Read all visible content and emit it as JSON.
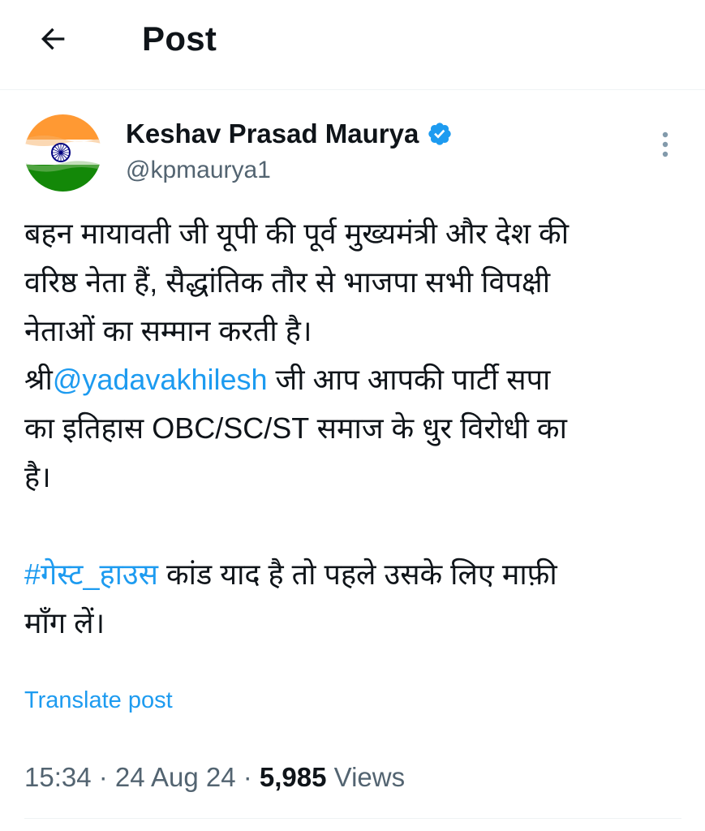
{
  "header": {
    "back_icon": "arrow-left-icon",
    "title": "Post"
  },
  "author": {
    "name": "Keshav Prasad Maurya",
    "handle": "@kpmaurya1",
    "verified_icon": "verified-badge-icon",
    "avatar_icon": "india-flag-avatar",
    "more_icon": "more-vertical-icon"
  },
  "tweet": {
    "line_1": "बहन मायावती जी यूपी की पूर्व मुख्यमंत्री और देश की",
    "line_2": "वरिष्ठ नेता हैं, सैद्धांतिक तौर से भाजपा सभी विपक्षी",
    "line_3": "नेताओं का सम्मान करती है।",
    "line_4_prefix": "श्री",
    "mention": "@yadavakhilesh",
    "line_4_suffix": " जी आप आपकी पार्टी सपा",
    "line_5": "का इतिहास OBC/SC/ST समाज के धुर विरोधी का",
    "line_6": "है।",
    "hashtag": "#गेस्ट_हाउस",
    "line_8_suffix": " कांड याद है तो पहले उसके लिए माफ़ी",
    "line_9": "माँग लें।"
  },
  "translate_label": "Translate post",
  "meta": {
    "time": "15:34",
    "sep": " · ",
    "date": "24 Aug 24",
    "views_count": "5,985",
    "views_label": " Views"
  },
  "colors": {
    "accent": "#1d9bf0",
    "secondary_text": "#536471",
    "divider": "#eff3f4",
    "saffron": "#ff9933",
    "green": "#138808",
    "chakra": "#000080"
  }
}
